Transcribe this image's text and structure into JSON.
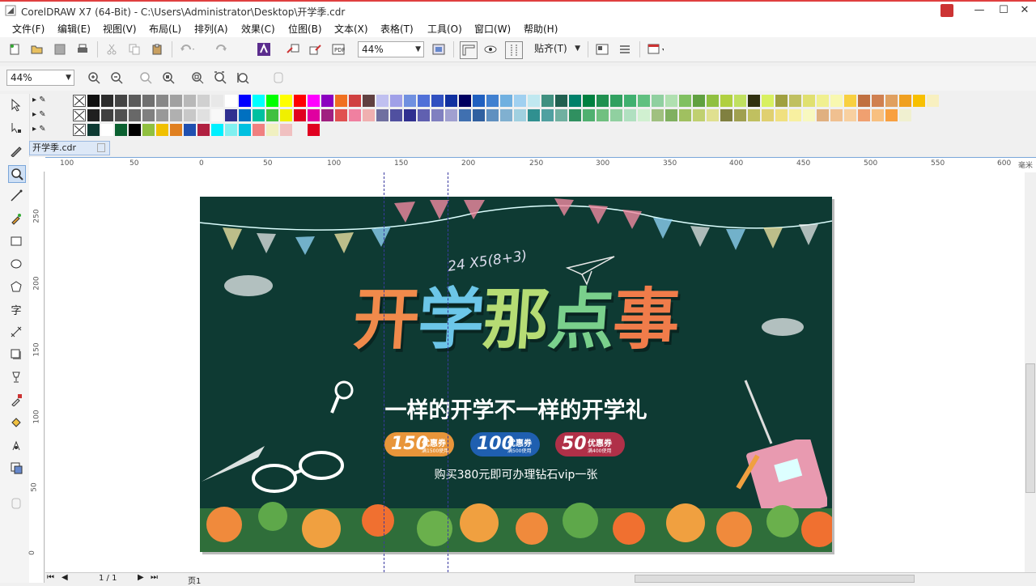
{
  "window": {
    "title": "CorelDRAW X7 (64-Bit) - C:\\Users\\Administrator\\Desktop\\开学季.cdr",
    "minimize": "—",
    "maximize": "☐",
    "close": "✕"
  },
  "menu": [
    "文件(F)",
    "编辑(E)",
    "视图(V)",
    "布局(L)",
    "排列(A)",
    "效果(C)",
    "位图(B)",
    "文本(X)",
    "表格(T)",
    "工具(O)",
    "窗口(W)",
    "帮助(H)"
  ],
  "toolbar": {
    "zoom_value": "44%",
    "snap_label": "贴齐(T)",
    "zoom_value2": "44%"
  },
  "palette": {
    "row1": [
      "#111111",
      "#2b2b2b",
      "#444444",
      "#5a5a5a",
      "#707070",
      "#888888",
      "#a0a0a0",
      "#b8b8b8",
      "#d0d0d0",
      "#e8e8e8",
      "#ffffff",
      "#0000ff",
      "#00ffff",
      "#00ff00",
      "#ffff00",
      "#ff0000",
      "#ff00ff",
      "#8b00c0",
      "#f07020",
      "#d04040",
      "#604040",
      "#c0c0f0",
      "#a0a0e8",
      "#7090e0",
      "#5070d8",
      "#3050c0",
      "#1030a0",
      "#000060",
      "#2060c0",
      "#4080d0",
      "#70b0e0",
      "#a0d0f0",
      "#c0e8f0",
      "#409080",
      "#206050",
      "#00806a",
      "#008040",
      "#209050",
      "#30a060",
      "#40b070",
      "#60c080",
      "#90d0a0",
      "#b0e0b0",
      "#80c060",
      "#60a040",
      "#90c040",
      "#b0d040",
      "#c0e060",
      "#303010",
      "#d8f060",
      "#a0a040",
      "#c0c060",
      "#e0e070",
      "#f0f090",
      "#f8f8b0",
      "#f8d040",
      "#c07040",
      "#d08050",
      "#e0a060",
      "#f0a020",
      "#f8c000",
      "#f8f0c0"
    ],
    "row2": [
      "#202020",
      "#404040",
      "#505050",
      "#686868",
      "#808080",
      "#989898",
      "#b0b0b0",
      "#c8c8c8",
      "#e0e0e0",
      "#f8f8f8",
      "#303090",
      "#0070c0",
      "#00c0a0",
      "#40c040",
      "#f0f000",
      "#e00020",
      "#e000a0",
      "#a02080",
      "#e05050",
      "#f080a0",
      "#f0b0b0",
      "#7070a0",
      "#5050a0",
      "#303090",
      "#6060b0",
      "#8080c0",
      "#a0a0d0",
      "#4070b0",
      "#3060a0",
      "#6090c0",
      "#80b0d0",
      "#a0d0e0",
      "#309090",
      "#50a0a0",
      "#70b0a0",
      "#309060",
      "#50b070",
      "#70c080",
      "#90d0a0",
      "#b0e0c0",
      "#d0f0d0",
      "#a0c080",
      "#80b060",
      "#a0c060",
      "#c0d070",
      "#e0e090",
      "#808040",
      "#a0a050",
      "#c0c060",
      "#e0d070",
      "#f0e080",
      "#f8f0a0",
      "#f8f8c0",
      "#e0b080",
      "#f0c090",
      "#f8d0a0",
      "#f0a070",
      "#f8c080",
      "#f8a040",
      "#f0f0d0"
    ],
    "row3": [
      "#0e3a33",
      "#ffffff",
      "#0a6030",
      "#000000",
      "#90c040",
      "#f0c000",
      "#e08020",
      "#2050b0",
      "#b02040",
      "#00f0ff",
      "#80f0f0",
      "#00c0e0",
      "#f08080",
      "#f0f0c0",
      "#f0c0c0",
      "#f0f0f0",
      "#e00020"
    ]
  },
  "doc_tab": "开学季.cdr",
  "ruler_h": [
    "100",
    "50",
    "0",
    "50",
    "100",
    "150",
    "200",
    "250",
    "300",
    "350",
    "400",
    "450",
    "500",
    "550",
    "600",
    "毫米"
  ],
  "ruler_v": [
    "250",
    "200",
    "150",
    "100",
    "50",
    "0"
  ],
  "design": {
    "formula": "24 X5(8+3)",
    "headline": [
      "开",
      "学",
      "那",
      "点",
      "事"
    ],
    "headline_colors": [
      "#f08a4b",
      "#6cc6e8",
      "#b6dc74",
      "#7ad08c",
      "#f07c4a"
    ],
    "subtitle": "一样的开学不一样的开学礼",
    "coupons": [
      {
        "amount": "150",
        "label": "优惠券",
        "cond": "满1500使用",
        "color": "#e8953a"
      },
      {
        "amount": "100",
        "label": "优惠券",
        "cond": "满500使用",
        "color": "#1f5fb0"
      },
      {
        "amount": "50",
        "label": "优惠券",
        "cond": "满400使用",
        "color": "#b03048"
      }
    ],
    "buy_line": "购买380元即可办理钻石vip一张"
  },
  "status": {
    "page": "1 / 1",
    "page_tab": "页1"
  }
}
